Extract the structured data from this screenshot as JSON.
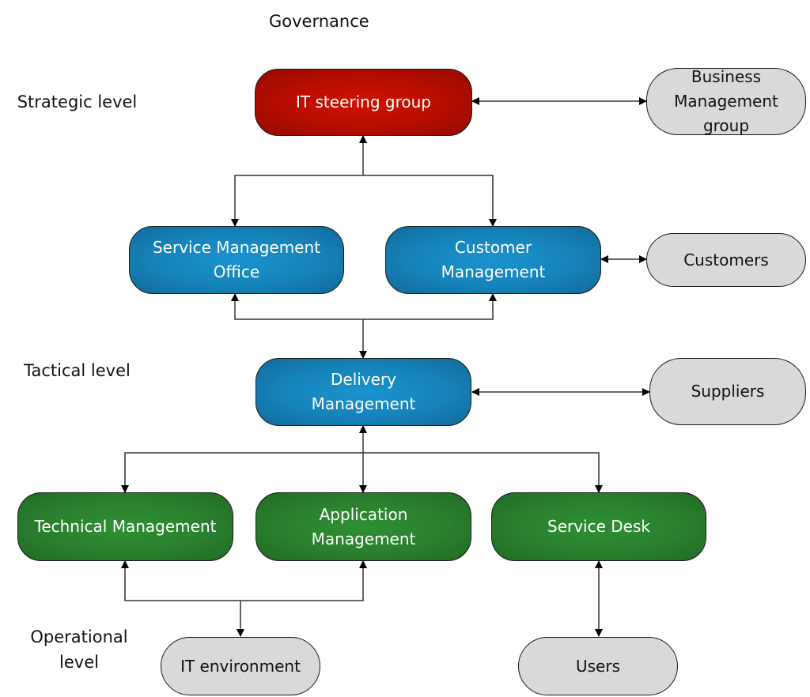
{
  "labels": {
    "governance": "Governance",
    "strategic": "Strategic level",
    "tactical": "Tactical level",
    "operational_line1": "Operational",
    "operational_line2": "level"
  },
  "nodes": {
    "it_steering": {
      "line1": "IT steering group",
      "color": "#c41000"
    },
    "service_mgmt_office": {
      "line1": "Service Management",
      "line2": "Office",
      "color": "#1782bb"
    },
    "customer_mgmt": {
      "line1": "Customer",
      "line2": "Management",
      "color": "#1782bb"
    },
    "delivery_mgmt": {
      "line1": "Delivery",
      "line2": "Management",
      "color": "#1782bb"
    },
    "technical_mgmt": {
      "line1": "Technical Management",
      "color": "#2a7f2e"
    },
    "application_mgmt": {
      "line1": "Application",
      "line2": "Management",
      "color": "#2a7f2e"
    },
    "service_desk": {
      "line1": "Service Desk",
      "color": "#2a7f2e"
    },
    "business_mgmt_group": {
      "line1": "Business",
      "line2": "Management",
      "line3": "group",
      "color": "#d9d9d9"
    },
    "customers": {
      "line1": "Customers",
      "color": "#d9d9d9"
    },
    "suppliers": {
      "line1": "Suppliers",
      "color": "#d9d9d9"
    },
    "it_environment": {
      "line1": "IT environment",
      "color": "#d9d9d9"
    },
    "users": {
      "line1": "Users",
      "color": "#d9d9d9"
    }
  }
}
